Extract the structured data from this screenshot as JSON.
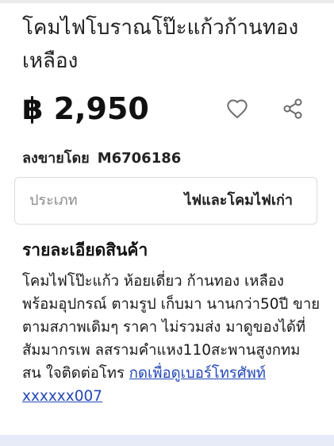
{
  "listing": {
    "title": "โคมไฟโบราณโป๊ะแก้วก้านทองเหลือง",
    "price": "฿ 2,950",
    "seller_label": "ลงขายโดย",
    "seller_id": "M6706186"
  },
  "category": {
    "label": "ประเภท",
    "value": "ไฟและโคมไฟเก่า"
  },
  "details": {
    "heading": "รายละเอียดสินค้า",
    "text": "โคมไฟโป๊ะแก้ว ห้อยเดี่ยว ก้านทอง เหลือง พร้อมอุปกรณ์ ตามรูป เก็บมา นานกว่า50ปี ขายตามสภาพเดิมๆ ราคา ไม่รวมส่ง มาดูของได้ที่สัมมากรเพ ลสรามคำแหง110สะพานสูงกทม สน ใจติดต่อโทร ",
    "phone_link": "กดเพื่อดูเบอร์โทรศัพท์",
    "phone_masked": "xxxxxx007"
  },
  "icons": {
    "favorite": "heart-outline-icon",
    "share": "share-icon"
  },
  "colors": {
    "link": "#2448b8",
    "icon": "#6b6b6b",
    "border": "#dcdcdc"
  }
}
